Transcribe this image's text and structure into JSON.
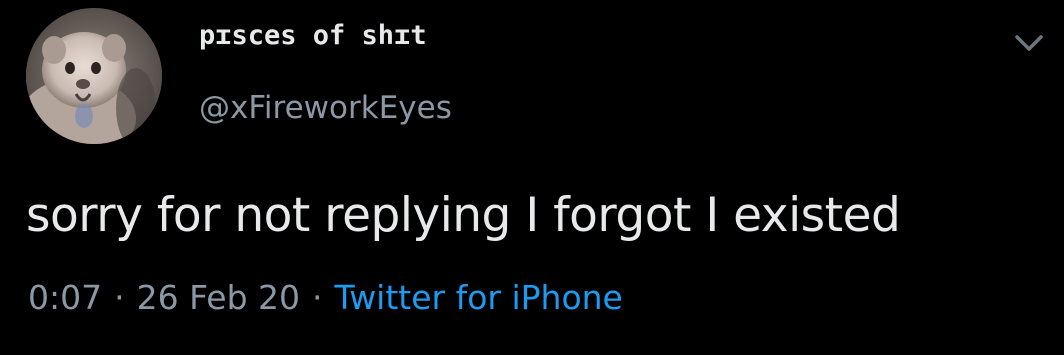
{
  "tweet": {
    "display_name": "pɪsces of shɪt",
    "handle": "@xFireworkEyes",
    "text": "sorry for not replying I forgot I existed",
    "time": "0:07",
    "separator": "·",
    "date": "26 Feb 20",
    "source": "Twitter for iPhone"
  },
  "colors": {
    "background": "#000000",
    "primary_text": "#e7e9ea",
    "secondary_text": "#8b98a5",
    "link": "#1d9bf0"
  },
  "icons": {
    "more_options": "chevron-down-icon",
    "avatar": "avatar"
  }
}
